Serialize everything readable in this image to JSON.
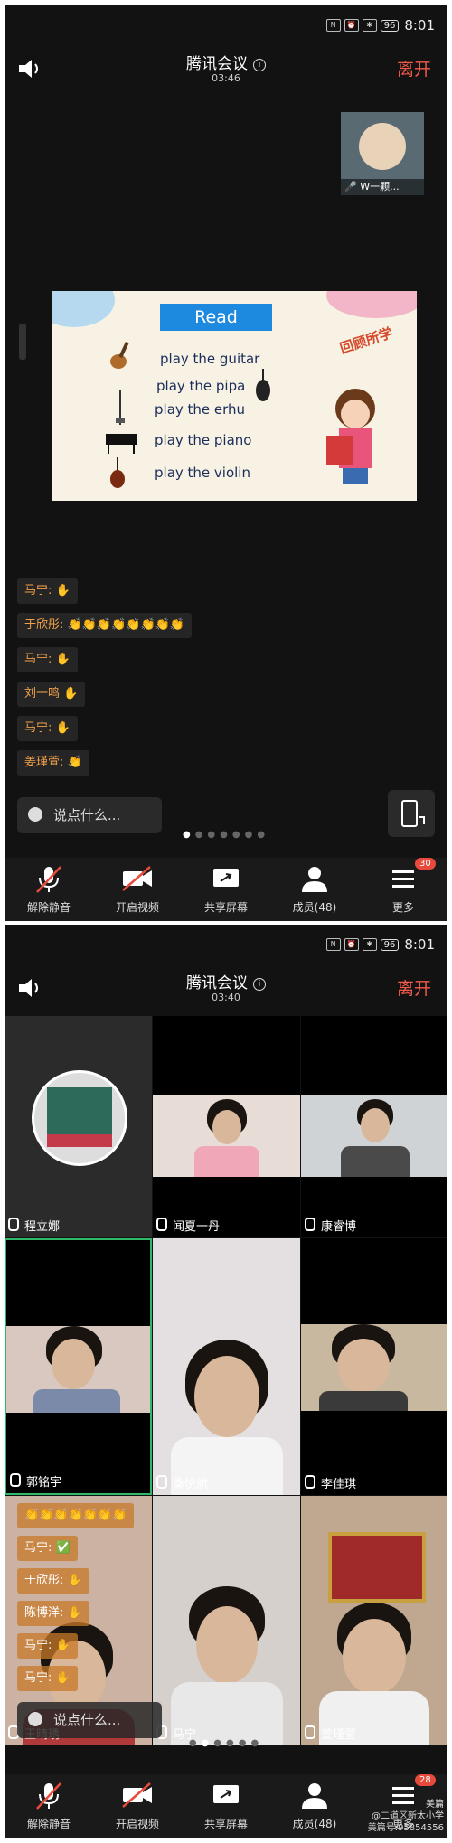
{
  "status_bar": {
    "battery": "96",
    "time": "8:01"
  },
  "screen1": {
    "title": "腾讯会议",
    "timer": "03:46",
    "leave_label": "离开",
    "self_view_name": "W一颗...",
    "slide": {
      "heading": "Read",
      "stamp": "回顾所学",
      "rows": [
        "play the guitar",
        "play the pipa",
        "play the erhu",
        "play the piano",
        "play the violin"
      ]
    },
    "chat_messages": [
      {
        "name": "马宁:",
        "emoji": "✋"
      },
      {
        "name": "于欣彤:",
        "emoji": "👏👏👏👏👏👏👏👏"
      },
      {
        "name": "马宁:",
        "emoji": "✋"
      },
      {
        "name": "刘一鸣",
        "emoji": "✋"
      },
      {
        "name": "马宁:",
        "emoji": "✋"
      },
      {
        "name": "姜瑾萱:",
        "emoji": "👏"
      }
    ],
    "input_placeholder": "说点什么...",
    "toolbar": [
      {
        "label": "解除静音",
        "icon": "mic-muted-icon"
      },
      {
        "label": "开启视频",
        "icon": "video-off-icon"
      },
      {
        "label": "共享屏幕",
        "icon": "share-screen-icon"
      },
      {
        "label": "成员(48)",
        "icon": "members-icon"
      },
      {
        "label": "更多",
        "icon": "more-icon",
        "badge": "30"
      }
    ]
  },
  "screen2": {
    "title": "腾讯会议",
    "timer": "03:40",
    "leave_label": "离开",
    "participants": [
      "程立娜",
      "闻夏一丹",
      "康睿博",
      "郭铭宇",
      "桑悦航",
      "李佳琪",
      "王晴琇",
      "马宁",
      "姜瑾萱"
    ],
    "chat_messages": [
      {
        "name": "马宁:",
        "emoji": "✅"
      },
      {
        "name": "于欣彤:",
        "emoji": "✋"
      },
      {
        "name": "陈博洋:",
        "emoji": "✋"
      },
      {
        "name": "马宁:",
        "emoji": "✋"
      },
      {
        "name": "马宁:",
        "emoji": "✋"
      }
    ],
    "input_placeholder": "说点什么...",
    "toolbar": [
      {
        "label": "解除静音",
        "icon": "mic-muted-icon"
      },
      {
        "label": "开启视频",
        "icon": "video-off-icon"
      },
      {
        "label": "共享屏幕",
        "icon": "share-screen-icon"
      },
      {
        "label": "成员(48)",
        "icon": "members-icon"
      },
      {
        "label": "更多",
        "icon": "more-icon",
        "badge": "28"
      }
    ],
    "watermark": {
      "brand": "美篇",
      "school": "@二道区新太小学",
      "id": "美篇号:95854556"
    }
  }
}
